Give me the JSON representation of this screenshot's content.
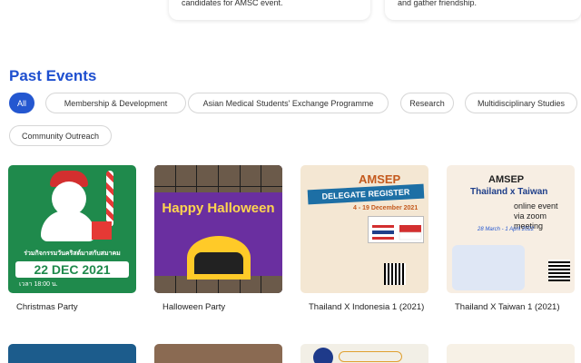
{
  "top_cards": [
    {
      "text": "candidates for AMSC event."
    },
    {
      "text": "and gather friendship."
    }
  ],
  "section": {
    "title": "Past Events"
  },
  "filters": [
    "All",
    "Membership & Development",
    "Asian Medical Students' Exchange Programme",
    "Research",
    "Multidisciplinary Studies",
    "Community Outreach"
  ],
  "active_filter": "All",
  "events": [
    {
      "title": "Christmas Party",
      "thumb": {
        "thai": "ร่วมกิจกรรมวันคริสต์มาสกับสมาคม",
        "date": "22 DEC 2021",
        "time": "เวลา 18:00 น."
      }
    },
    {
      "title": "Halloween Party",
      "thumb": {
        "heading": "Happy Halloween"
      }
    },
    {
      "title": "Thailand X Indonesia 1 (2021)",
      "thumb": {
        "line1": "AMSEP",
        "line2": "DELEGATE REGISTER",
        "line3": "4 - 19 December 2021"
      }
    },
    {
      "title": "Thailand X Taiwan 1 (2021)",
      "thumb": {
        "line1": "AMSEP",
        "line2": "Thailand x Taiwan",
        "line3": "online event via zoom meeting",
        "line4": "28 March - 1 April 2022"
      }
    }
  ],
  "colors": {
    "accent": "#2457d0",
    "title": "#1e4fcf"
  }
}
